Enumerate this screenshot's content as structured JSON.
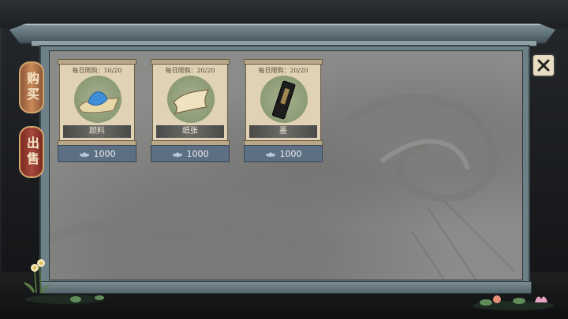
{
  "shop": {
    "tabs": [
      {
        "label": "购买",
        "active": true
      },
      {
        "label": "出售",
        "active": false
      }
    ],
    "items": [
      {
        "limit": "每日限购：10/20",
        "name": "颜料",
        "price": "1000",
        "icon": "pigment-icon"
      },
      {
        "limit": "每日限购：20/20",
        "name": "纸张",
        "price": "1000",
        "icon": "paper-icon"
      },
      {
        "limit": "每日限购：20/20",
        "name": "墨",
        "price": "1000",
        "icon": "ink-stick-icon"
      }
    ],
    "currency_icon": "silver-ingot-icon",
    "close_icon": "close-icon"
  },
  "colors": {
    "tab_active": "#c98b5a",
    "tab_inactive": "#a8483b",
    "price_bar": "#5d6f82",
    "card": "#dfd2b5"
  }
}
